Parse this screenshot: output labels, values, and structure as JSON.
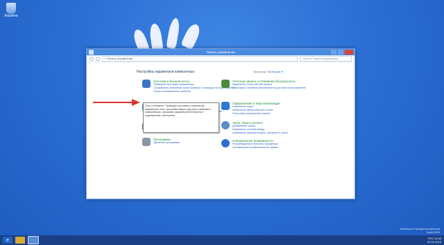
{
  "desktop": {
    "recycle_bin_label": "Корзина"
  },
  "window": {
    "title": "Панель управления",
    "address_path": "« Панель управления",
    "search_placeholder": "Поиск в панели управления"
  },
  "content": {
    "heading": "Настройка параметров компьютера",
    "view_by_label": "Просмотр:",
    "view_by_value": "Категория ▾",
    "categories": [
      {
        "icon": "shield-icon",
        "title": "Система и безопасность",
        "links": [
          "Проверка состояния компьютера",
          "Сохранение резервных копий файлов с помощью истории файлов",
          "Поиск и исправление проблем"
        ]
      },
      {
        "icon": "network-icon",
        "title": "Сеть и Интернет",
        "links": [
          "Просмотр состояния сети и задач",
          "Выбор домашней группы и параметров общего доступа"
        ]
      },
      {
        "icon": "hardware-icon",
        "title": "Оборудование и звук",
        "links": [
          "Просмотр устройств и принтеров",
          "Добавление устройства"
        ]
      },
      {
        "icon": "programs-icon",
        "title": "Программы",
        "links": [
          "Удаление программы"
        ]
      },
      {
        "icon": "users-icon",
        "title": "Учетные записи и Семейная безопасность",
        "links": [
          "Изменение типа учетной записи",
          "Установка Семейной безопасности для всех пользователей"
        ]
      },
      {
        "icon": "appearance-icon",
        "title": "Оформление и персонализация",
        "links": [
          "Изменение темы",
          "Изменение фона рабочего стола",
          "Настройка разрешения экрана"
        ]
      },
      {
        "icon": "clock-icon",
        "title": "Часы, язык и регион",
        "links": [
          "Добавление языка",
          "Изменение способа ввода",
          "Изменение форматов даты, времени и чисел"
        ]
      },
      {
        "icon": "accessibility-icon",
        "title": "Специальные возможности",
        "links": [
          "Рекомендуемые Windows параметры",
          "Оптимизация изображения на экране"
        ]
      }
    ],
    "tooltip": "Сеть и Интернет. Проверка состояния и изменение параметров сети, настройка общего доступа к файлам и компьютерам, настройка параметров Интернета и подключения к Интернету."
  },
  "watermark": {
    "line1": "Windows 8 Профессиональная",
    "line2": "Build 9200"
  },
  "taskbar": {
    "time": "12:00",
    "date": "01.01.2013",
    "lang": "РУС"
  }
}
